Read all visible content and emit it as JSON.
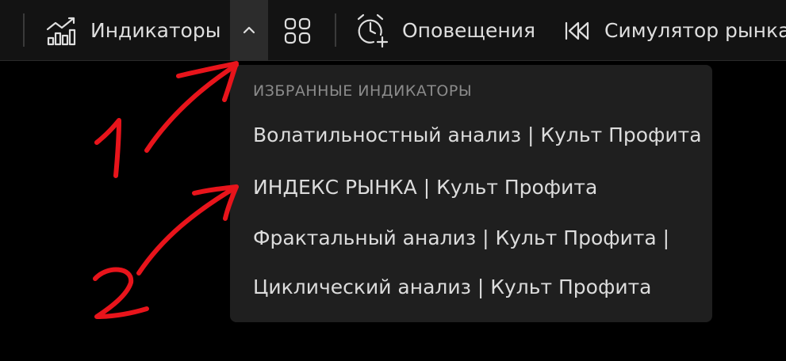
{
  "toolbar": {
    "indicators_label": "Индикаторы",
    "alerts_label": "Оповещения",
    "simulator_label": "Симулятор рынка",
    "icons": {
      "indicators": "chart-bars-icon",
      "chevron": "chevron-up-icon",
      "templates": "grid-icon",
      "alerts": "alarm-plus-icon",
      "simulator": "rewind-icon"
    }
  },
  "favorites_menu": {
    "heading": "ИЗБРАННЫЕ ИНДИКАТОРЫ",
    "items": [
      "Волатильностный анализ | Культ Профита",
      "ИНДЕКС РЫНКА | Культ Профита",
      "Фрактальный анализ | Культ Профита |",
      "Циклический анализ | Культ Профита"
    ]
  },
  "annotations": {
    "marker_1": "1",
    "marker_2": "2",
    "color": "#e8141b"
  },
  "colors": {
    "toolbar_bg": "#131313",
    "menu_bg": "#1f1f1f",
    "text": "#dedede",
    "heading": "#8b8b8b",
    "active_button_bg": "#2c2c2c"
  }
}
